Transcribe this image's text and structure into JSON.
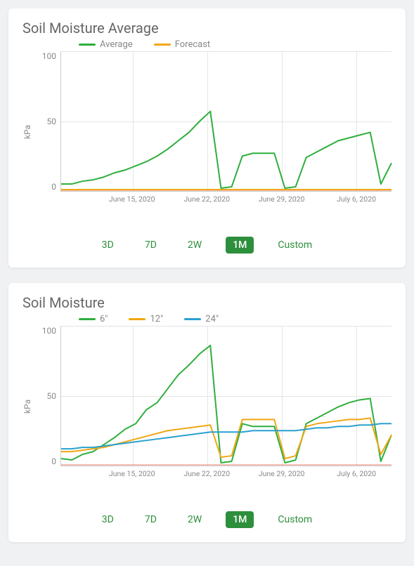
{
  "charts": [
    {
      "title": "Soil Moisture Average",
      "legend": [
        {
          "label": "Average",
          "color": "#2eaf3d"
        },
        {
          "label": "Forecast",
          "color": "#f0a712"
        }
      ],
      "ylabel": "kPa",
      "ylim": [
        0,
        100
      ],
      "yticks": [
        0,
        50,
        100
      ],
      "xticks": [
        "June 15, 2020",
        "June 22, 2020",
        "June 29, 2020",
        "July 6, 2020"
      ],
      "range_tabs": [
        "3D",
        "7D",
        "2W",
        "1M",
        "Custom"
      ],
      "active_range": "1M"
    },
    {
      "title": "Soil Moisture",
      "legend": [
        {
          "label": "6\"",
          "color": "#2eaf3d"
        },
        {
          "label": "12\"",
          "color": "#f0a712"
        },
        {
          "label": "24\"",
          "color": "#2aa0cf"
        }
      ],
      "ylabel": "kPa",
      "ylim": [
        0,
        100
      ],
      "yticks": [
        0,
        50,
        100
      ],
      "xticks": [
        "June 15, 2020",
        "June 22, 2020",
        "June 29, 2020",
        "July 6, 2020"
      ],
      "range_tabs": [
        "3D",
        "7D",
        "2W",
        "1M",
        "Custom"
      ],
      "active_range": "1M"
    }
  ],
  "chart_data": [
    {
      "type": "line",
      "title": "Soil Moisture Average",
      "xlabel": "",
      "ylabel": "kPa",
      "ylim": [
        0,
        100
      ],
      "x_dates": [
        "2020-06-08",
        "2020-06-09",
        "2020-06-10",
        "2020-06-11",
        "2020-06-12",
        "2020-06-13",
        "2020-06-14",
        "2020-06-15",
        "2020-06-16",
        "2020-06-17",
        "2020-06-18",
        "2020-06-19",
        "2020-06-20",
        "2020-06-21",
        "2020-06-22",
        "2020-06-23",
        "2020-06-24",
        "2020-06-25",
        "2020-06-26",
        "2020-06-27",
        "2020-06-28",
        "2020-06-29",
        "2020-06-30",
        "2020-07-01",
        "2020-07-02",
        "2020-07-03",
        "2020-07-04",
        "2020-07-05",
        "2020-07-06",
        "2020-07-07",
        "2020-07-08",
        "2020-07-09"
      ],
      "series": [
        {
          "name": "Average",
          "color": "#2eaf3d",
          "values": [
            5,
            5,
            7,
            8,
            10,
            13,
            15,
            18,
            21,
            25,
            30,
            36,
            42,
            50,
            57,
            2,
            3,
            25,
            27,
            27,
            27,
            2,
            3,
            24,
            28,
            32,
            36,
            38,
            40,
            42,
            5,
            20
          ]
        },
        {
          "name": "Forecast",
          "color": "#f0a712",
          "values": [
            1,
            1,
            1,
            1,
            1,
            1,
            1,
            1,
            1,
            1,
            1,
            1,
            1,
            1,
            1,
            1,
            1,
            1,
            1,
            1,
            1,
            1,
            1,
            1,
            1,
            1,
            1,
            1,
            1,
            1,
            1,
            1
          ]
        }
      ]
    },
    {
      "type": "line",
      "title": "Soil Moisture",
      "xlabel": "",
      "ylabel": "kPa",
      "ylim": [
        0,
        100
      ],
      "x_dates": [
        "2020-06-08",
        "2020-06-09",
        "2020-06-10",
        "2020-06-11",
        "2020-06-12",
        "2020-06-13",
        "2020-06-14",
        "2020-06-15",
        "2020-06-16",
        "2020-06-17",
        "2020-06-18",
        "2020-06-19",
        "2020-06-20",
        "2020-06-21",
        "2020-06-22",
        "2020-06-23",
        "2020-06-24",
        "2020-06-25",
        "2020-06-26",
        "2020-06-27",
        "2020-06-28",
        "2020-06-29",
        "2020-06-30",
        "2020-07-01",
        "2020-07-02",
        "2020-07-03",
        "2020-07-04",
        "2020-07-05",
        "2020-07-06",
        "2020-07-07",
        "2020-07-08",
        "2020-07-09"
      ],
      "series": [
        {
          "name": "6\"",
          "color": "#2eaf3d",
          "values": [
            5,
            4,
            8,
            10,
            15,
            20,
            26,
            30,
            40,
            45,
            55,
            65,
            72,
            80,
            86,
            2,
            3,
            30,
            28,
            28,
            28,
            2,
            4,
            30,
            34,
            38,
            42,
            45,
            47,
            48,
            3,
            22
          ]
        },
        {
          "name": "12\"",
          "color": "#f0a712",
          "values": [
            10,
            10,
            11,
            12,
            13,
            15,
            17,
            19,
            21,
            23,
            25,
            26,
            27,
            28,
            29,
            6,
            7,
            33,
            33,
            33,
            33,
            5,
            7,
            28,
            30,
            31,
            32,
            33,
            33,
            34,
            8,
            22
          ]
        },
        {
          "name": "24\"",
          "color": "#2aa0cf",
          "values": [
            12,
            12,
            13,
            13,
            14,
            15,
            16,
            17,
            18,
            19,
            20,
            21,
            22,
            23,
            24,
            24,
            24,
            24,
            25,
            25,
            25,
            25,
            25,
            26,
            27,
            27,
            28,
            28,
            29,
            29,
            30,
            30
          ]
        }
      ]
    }
  ]
}
